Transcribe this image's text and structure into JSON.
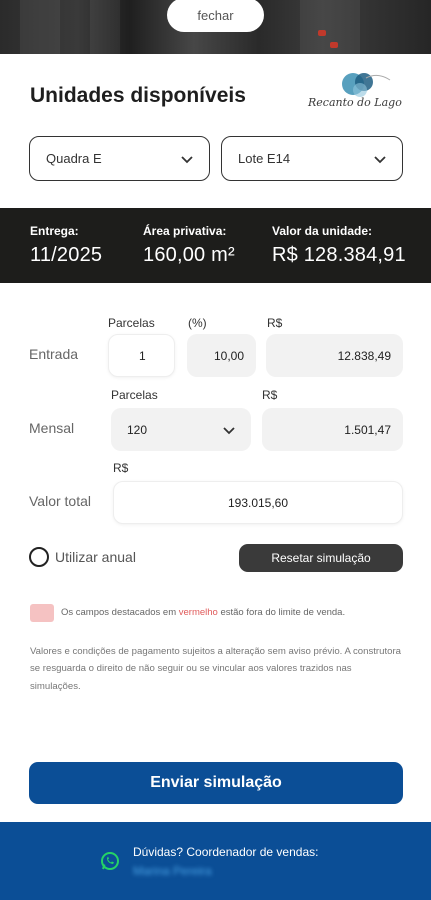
{
  "close_label": "fechar",
  "title": "Unidades disponíveis",
  "logo_text": "Recanto do Lago",
  "selects": {
    "quadra": "Quadra E",
    "lote": "Lote E14"
  },
  "info": {
    "entrega_label": "Entrega:",
    "entrega_value": "11/2025",
    "area_label": "Área privativa:",
    "area_value": "160,00 m²",
    "valor_label": "Valor da unidade:",
    "valor_value": "R$ 128.384,91"
  },
  "entrada": {
    "row_label": "Entrada",
    "parcelas_label": "Parcelas",
    "pct_label": "(%)",
    "rs_label": "R$",
    "parcelas_value": "1",
    "pct_value": "10,00",
    "rs_value": "12.838,49"
  },
  "mensal": {
    "row_label": "Mensal",
    "parcelas_label": "Parcelas",
    "rs_label": "R$",
    "parcelas_value": "120",
    "rs_value": "1.501,47"
  },
  "total": {
    "row_label": "Valor total",
    "rs_label": "R$",
    "value": "193.015,60"
  },
  "anual_label": "Utilizar anual",
  "reset_label": "Resetar simulação",
  "legend": {
    "before": "Os campos destacados em ",
    "red_word": "vermelho",
    "after": " estão fora do limite de venda."
  },
  "disclaimer": "Valores e condições de pagamento sujeitos a alteração sem aviso prévio. A construtora se resguarda o direito de não seguir ou se vincular aos valores trazidos nas simulações.",
  "send_label": "Enviar simulação",
  "footer": {
    "text": "Dúvidas? Coordenador de vendas:",
    "link": "Marina Pereira"
  },
  "colors": {
    "primary": "#0b4e96",
    "dark": "#1d1d1b",
    "reset": "#3a3a3a",
    "whatsapp": "#25d366",
    "warning": "#e05a5a"
  }
}
